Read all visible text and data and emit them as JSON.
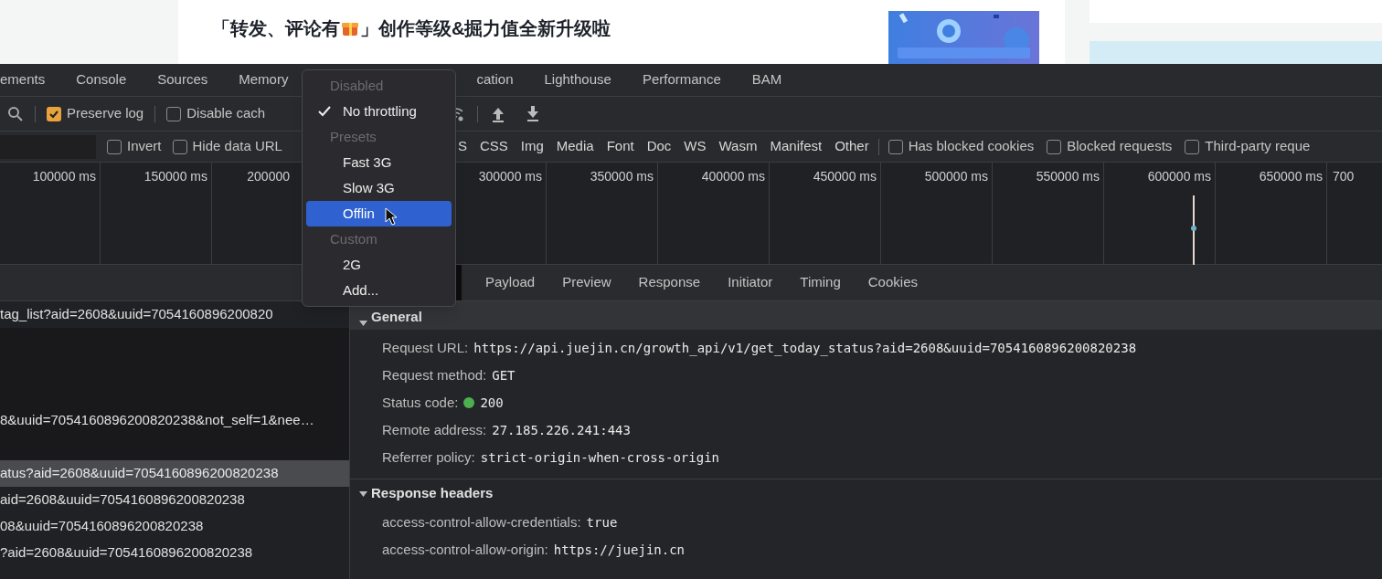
{
  "page": {
    "headline_before": "「转发、评论有",
    "headline_after": "」创作等级&掘力值全新升级啦"
  },
  "devtools": {
    "tabs": [
      {
        "label": "ements",
        "selected": false
      },
      {
        "label": "Console",
        "selected": false
      },
      {
        "label": "Sources",
        "selected": false
      },
      {
        "label": "Memory",
        "selected": false
      },
      {
        "label": "cation",
        "selected": false
      },
      {
        "label": "Lighthouse",
        "selected": false
      },
      {
        "label": "Performance",
        "selected": false
      },
      {
        "label": "BAM",
        "selected": false
      }
    ],
    "toolbar": {
      "checkboxes": [
        {
          "label": "Preserve log",
          "checked": true
        },
        {
          "label": "Disable cach",
          "checked": false
        }
      ]
    },
    "filters": {
      "checkboxes": [
        {
          "label": "Invert",
          "checked": false
        },
        {
          "label": "Hide data URL",
          "checked": false
        }
      ],
      "types": [
        "S",
        "CSS",
        "Img",
        "Media",
        "Font",
        "Doc",
        "WS",
        "Wasm",
        "Manifest",
        "Other"
      ],
      "extra": [
        {
          "label": "Has blocked cookies",
          "checked": false
        },
        {
          "label": "Blocked requests",
          "checked": false
        },
        {
          "label": "Third-party reque",
          "checked": false
        }
      ]
    },
    "timeline": {
      "ticks": [
        {
          "label": "100000 ms"
        },
        {
          "label": "150000 ms"
        },
        {
          "label": "200000",
          "cut": true
        },
        {
          "label": "300000 ms",
          "gap_before": true
        },
        {
          "label": "350000 ms"
        },
        {
          "label": "400000 ms"
        },
        {
          "label": "450000 ms"
        },
        {
          "label": "500000 ms"
        },
        {
          "label": "550000 ms"
        },
        {
          "label": "600000 ms"
        },
        {
          "label": "650000 ms"
        },
        {
          "label": "700",
          "cut": true
        }
      ]
    },
    "requests": [
      {
        "name": "tag_list?aid=2608&uuid=7054160896200820",
        "selected": false
      },
      {
        "name": "8&uuid=7054160896200820238&not_self=1&nee…",
        "selected": false
      },
      {
        "name": "atus?aid=2608&uuid=7054160896200820238",
        "selected": true
      },
      {
        "name": "aid=2608&uuid=7054160896200820238",
        "selected": false
      },
      {
        "name": "08&uuid=7054160896200820238",
        "selected": false
      },
      {
        "name": "?aid=2608&uuid=7054160896200820238",
        "selected": false
      }
    ],
    "detail_tabs": [
      {
        "label": "Payload",
        "selected": false
      },
      {
        "label": "Preview",
        "selected": false
      },
      {
        "label": "Response",
        "selected": false
      },
      {
        "label": "Initiator",
        "selected": false
      },
      {
        "label": "Timing",
        "selected": false
      },
      {
        "label": "Cookies",
        "selected": false
      }
    ],
    "sections": [
      {
        "title": "General",
        "expanded": true,
        "fields": [
          {
            "label": "Request URL:",
            "value": "https://api.juejin.cn/growth_api/v1/get_today_status?aid=2608&uuid=7054160896200820238"
          },
          {
            "label": "Request method:",
            "value": "GET"
          },
          {
            "label": "Status code:",
            "value": "200",
            "color": "#4caf50"
          },
          {
            "label": "Remote address:",
            "value": "27.185.226.241:443"
          },
          {
            "label": "Referrer policy:",
            "value": "strict-origin-when-cross-origin"
          }
        ]
      },
      {
        "title": "Response headers",
        "expanded": true,
        "fields": [
          {
            "label": "access-control-allow-credentials:",
            "value": "true"
          },
          {
            "label": "access-control-allow-origin:",
            "value": "https://juejin.cn"
          }
        ]
      }
    ]
  },
  "throttle_menu": {
    "items": [
      {
        "kind": "header",
        "label": "Disabled"
      },
      {
        "kind": "option",
        "label": "No throttling",
        "checked": true,
        "selected": false
      },
      {
        "kind": "header",
        "label": "Presets"
      },
      {
        "kind": "option",
        "label": "Fast 3G",
        "checked": false,
        "selected": false
      },
      {
        "kind": "option",
        "label": "Slow 3G",
        "checked": false,
        "selected": false
      },
      {
        "kind": "option",
        "label": "Offlin",
        "checked": false,
        "selected": true
      },
      {
        "kind": "header",
        "label": "Custom"
      },
      {
        "kind": "option",
        "label": "2G",
        "checked": false,
        "selected": false
      },
      {
        "kind": "option",
        "label": "Add...",
        "checked": false,
        "selected": false
      }
    ]
  }
}
